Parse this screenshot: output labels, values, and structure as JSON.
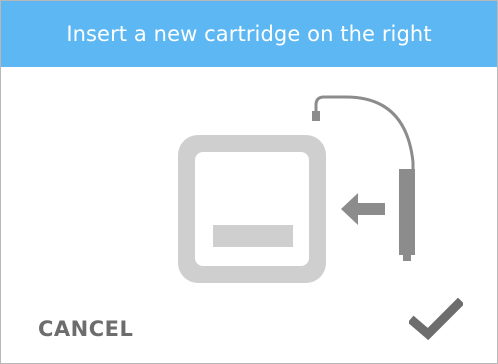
{
  "dialog": {
    "title": "Insert a new cartridge on the right",
    "cancel_label": "CANCEL"
  },
  "icons": {
    "confirm": "checkmark-icon",
    "illustration": "cartridge-slot-icon",
    "arrow": "arrow-left-icon",
    "cartridge": "cartridge-with-cable-icon"
  },
  "colors": {
    "header_bg": "#5db7f3",
    "header_text": "#ffffff",
    "slot_outer": "#cfcfcf",
    "slot_inner": "#ffffff",
    "slot_bar": "#cfcfcf",
    "arrow": "#8c8c8c",
    "cartridge": "#8c8c8c",
    "cancel_text": "#6d6d6d",
    "check": "#6d6d6d"
  }
}
